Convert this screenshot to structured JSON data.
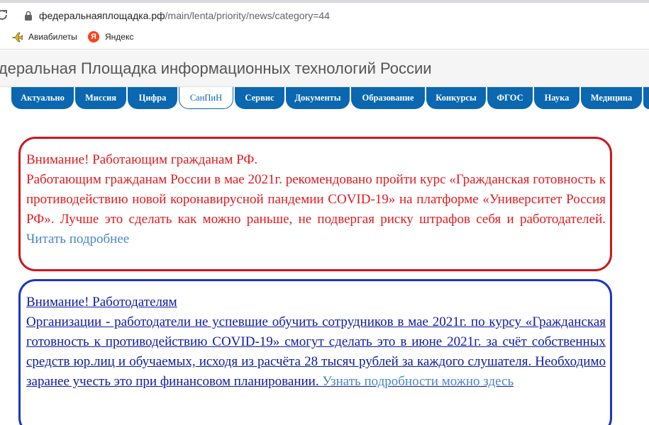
{
  "browser": {
    "url_host": "федеральнаяплощадка.рф",
    "url_path": "/main/lenta/priority/news/category=44"
  },
  "bookmarks": [
    {
      "label": "Авиабилеты",
      "icon": "airplane-icon"
    },
    {
      "label": "Яндекс",
      "icon": "yandex-icon",
      "glyph": "Я"
    }
  ],
  "site": {
    "title": "едеральная Площадка информационных технологий России"
  },
  "nav": {
    "tabs": [
      {
        "label": "Актуально"
      },
      {
        "label": "Миссия"
      },
      {
        "label": "Цифра"
      },
      {
        "label": "СанПиН",
        "active": true
      },
      {
        "label": "Сервис"
      },
      {
        "label": "Документы"
      },
      {
        "label": "Образование"
      },
      {
        "label": "Конкурсы"
      },
      {
        "label": "ФГОС"
      },
      {
        "label": "Наука"
      },
      {
        "label": "Медицина"
      }
    ]
  },
  "notice_workers": {
    "heading": "Внимание! Работающим гражданам РФ.",
    "body": "Работающим гражданам России в мае 2021г. рекомендовано пройти курс «Гражданская готовность к противодействию новой коронавирусной пандемии COVID-19» на платформе «Университет Россия РФ». Лучше это сделать как можно раньше, не подвергая риску штрафов себя и работодателей.",
    "link": "Читать подробнее"
  },
  "notice_employers": {
    "heading": "Внимание! Работодателям",
    "body": "Организации - работодатели не успевшие обучить сотрудников в мае 2021г. по курсу «Гражданская готовность к противодействию COVID-19»  смогут сделать это в июне 2021г. за счёт собственных средств юр.лиц и обучаемых, исходя из расчёта 28 тысяч рублей за каждого слушателя. Необходимо заранее учесть это при финансовом планировании.",
    "link": "Узнать подробности можно здесь"
  },
  "colors": {
    "nav_blue": "#0a67b0",
    "notice_red": "#e0191e",
    "notice_blue_text": "#0c1aa0",
    "link_blue": "#4a84c4"
  }
}
